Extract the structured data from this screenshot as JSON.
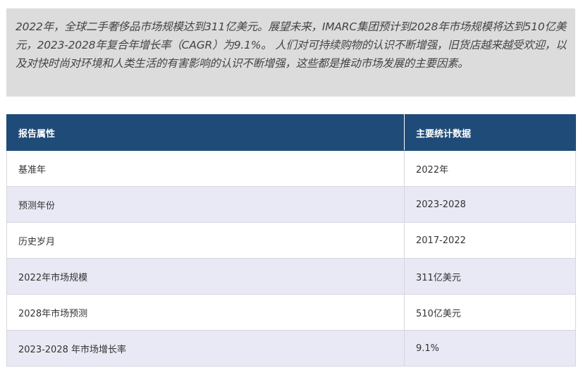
{
  "summary": {
    "text": "2022年，全球二手奢侈品市场规模达到311亿美元。展望未来，IMARC集团预计到2028年市场规模将达到510亿美元，2023-2028年复合年增长率（CAGR）为9.1%。 人们对可持续购物的认识不断增强，旧货店越来越受欢迎，以及对快时尚对环境和人类生活的有害影响的认识不断增强，这些都是推动市场发展的主要因素。"
  },
  "table": {
    "headers": [
      "报告属性",
      "主要统计数据"
    ],
    "rows": [
      {
        "attribute": "基准年",
        "value": "2022年"
      },
      {
        "attribute": "预测年份",
        "value": "2023-2028"
      },
      {
        "attribute": "历史岁月",
        "value": "2017-2022"
      },
      {
        "attribute": "2022年市场规模",
        "value": "311亿美元"
      },
      {
        "attribute": "2028年市场预测",
        "value": "510亿美元"
      },
      {
        "attribute": "2023-2028 年市场增长率",
        "value": "9.1%"
      }
    ]
  }
}
